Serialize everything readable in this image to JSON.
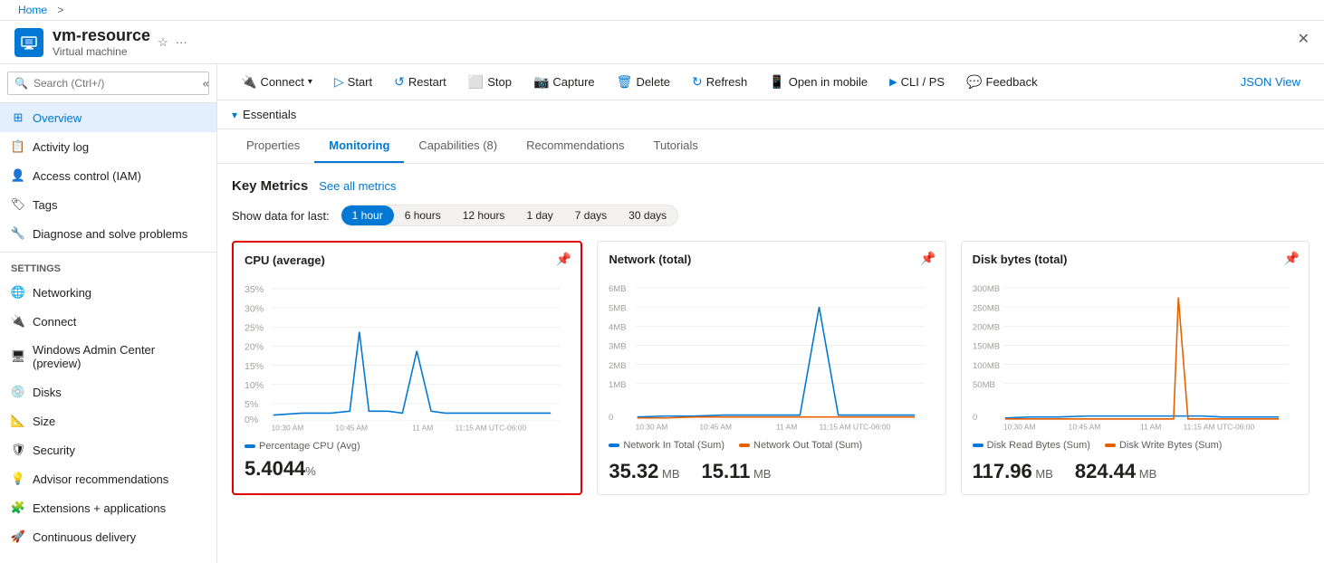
{
  "breadcrumb": {
    "home": "Home",
    "separator": ">"
  },
  "resource": {
    "name": "vm-resource",
    "type": "Virtual machine"
  },
  "header_icons": {
    "favorite": "☆",
    "more": "···"
  },
  "close_label": "✕",
  "search": {
    "placeholder": "Search (Ctrl+/)"
  },
  "sidebar": {
    "items": [
      {
        "label": "Overview",
        "active": true,
        "icon": "grid"
      },
      {
        "label": "Activity log",
        "active": false,
        "icon": "list"
      },
      {
        "label": "Access control (IAM)",
        "active": false,
        "icon": "person"
      },
      {
        "label": "Tags",
        "active": false,
        "icon": "tag"
      },
      {
        "label": "Diagnose and solve problems",
        "active": false,
        "icon": "wrench"
      }
    ],
    "settings_label": "Settings",
    "settings_items": [
      {
        "label": "Networking",
        "icon": "network"
      },
      {
        "label": "Connect",
        "icon": "connect"
      },
      {
        "label": "Windows Admin Center (preview)",
        "icon": "admin"
      },
      {
        "label": "Disks",
        "icon": "disk"
      },
      {
        "label": "Size",
        "icon": "size"
      },
      {
        "label": "Security",
        "icon": "shield"
      },
      {
        "label": "Advisor recommendations",
        "icon": "advisor"
      },
      {
        "label": "Extensions + applications",
        "icon": "extensions"
      },
      {
        "label": "Continuous delivery",
        "icon": "delivery"
      }
    ]
  },
  "toolbar": {
    "buttons": [
      {
        "label": "Connect",
        "icon": "🔌",
        "has_dropdown": true
      },
      {
        "label": "Start",
        "icon": "▷"
      },
      {
        "label": "Restart",
        "icon": "↺"
      },
      {
        "label": "Stop",
        "icon": "⬜"
      },
      {
        "label": "Capture",
        "icon": "📷"
      },
      {
        "label": "Delete",
        "icon": "🗑"
      },
      {
        "label": "Refresh",
        "icon": "↻"
      },
      {
        "label": "Open in mobile",
        "icon": "📱"
      },
      {
        "label": "CLI / PS",
        "icon": ">"
      },
      {
        "label": "Feedback",
        "icon": "💬"
      }
    ],
    "json_view": "JSON View"
  },
  "essentials": {
    "label": "Essentials",
    "collapsed": false
  },
  "tabs": [
    {
      "label": "Properties",
      "active": false
    },
    {
      "label": "Monitoring",
      "active": true
    },
    {
      "label": "Capabilities (8)",
      "active": false
    },
    {
      "label": "Recommendations",
      "active": false
    },
    {
      "label": "Tutorials",
      "active": false
    }
  ],
  "metrics": {
    "title": "Key Metrics",
    "see_all": "See all metrics",
    "time_label": "Show data for last:",
    "time_options": [
      {
        "label": "1 hour",
        "active": true
      },
      {
        "label": "6 hours",
        "active": false
      },
      {
        "label": "12 hours",
        "active": false
      },
      {
        "label": "1 day",
        "active": false
      },
      {
        "label": "7 days",
        "active": false
      },
      {
        "label": "30 days",
        "active": false
      }
    ]
  },
  "charts": {
    "cpu": {
      "title": "CPU (average)",
      "selected": true,
      "legend": [
        {
          "label": "Percentage CPU (Avg)",
          "color": "#0078d4"
        }
      ],
      "value": "5.4044",
      "unit": "%",
      "y_labels": [
        "35%",
        "30%",
        "25%",
        "20%",
        "15%",
        "10%",
        "5%",
        "0%"
      ],
      "x_labels": [
        "10:30 AM",
        "10:45 AM",
        "11 AM",
        "11:15 AM UTC-06:00"
      ]
    },
    "network": {
      "title": "Network (total)",
      "selected": false,
      "legend": [
        {
          "label": "Network In Total (Sum)",
          "color": "#0078d4"
        },
        {
          "label": "Network Out Total (Sum)",
          "color": "#e66000"
        }
      ],
      "values": [
        {
          "amount": "35.32",
          "unit": "MB"
        },
        {
          "amount": "15.11",
          "unit": "MB"
        }
      ],
      "y_labels": [
        "6MB",
        "5MB",
        "4MB",
        "3MB",
        "2MB",
        "1MB",
        "0"
      ],
      "x_labels": [
        "10:30 AM",
        "10:45 AM",
        "11 AM",
        "11:15 AM UTC-06:00"
      ]
    },
    "disk": {
      "title": "Disk bytes (total)",
      "selected": false,
      "legend": [
        {
          "label": "Disk Read Bytes (Sum)",
          "color": "#0078d4"
        },
        {
          "label": "Disk Write Bytes (Sum)",
          "color": "#e66000"
        }
      ],
      "values": [
        {
          "amount": "117.96",
          "unit": "MB"
        },
        {
          "amount": "824.44",
          "unit": "MB"
        }
      ],
      "y_labels": [
        "300MB",
        "250MB",
        "200MB",
        "150MB",
        "100MB",
        "50MB",
        "0"
      ],
      "x_labels": [
        "10:30 AM",
        "10:45 AM",
        "11 AM",
        "11:15 AM UTC-06:00"
      ]
    }
  }
}
